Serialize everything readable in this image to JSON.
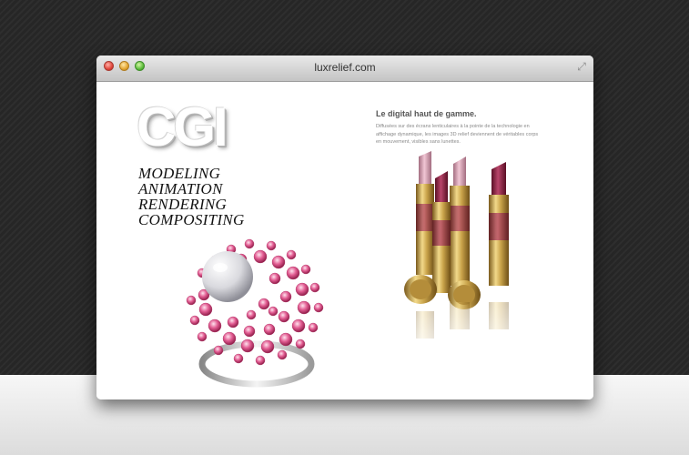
{
  "window": {
    "title": "luxrelief.com"
  },
  "hero": {
    "logo_text": "CGI",
    "services": [
      "MODELING",
      "ANIMATION",
      "RENDERING",
      "COMPOSITING"
    ]
  },
  "feature": {
    "headline": "Le digital haut de gamme.",
    "description": "Diffusées sur des écrans lenticulaires à la pointe de la technologie en affichage dynamique, les images 3D relief deviennent de véritables corps en mouvement, visibles sans lunettes."
  },
  "colors": {
    "accent_pink": "#d9477f",
    "lipstick_red": "#8c1f3d",
    "gold": "#c9a34a"
  }
}
